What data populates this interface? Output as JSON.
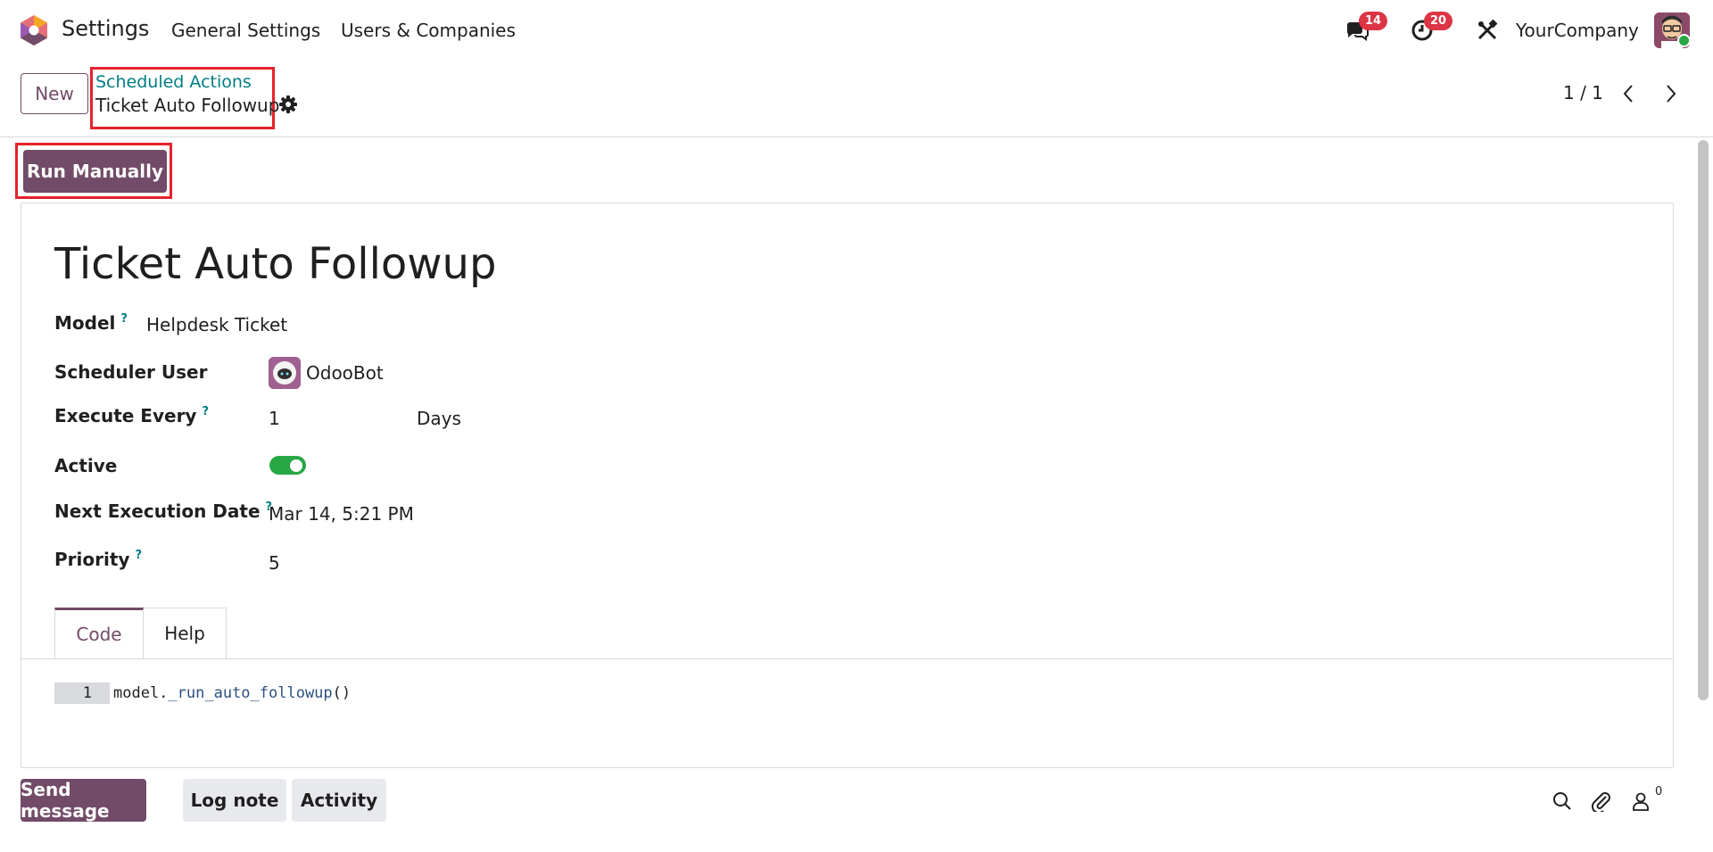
{
  "navbar": {
    "app_name": "Settings",
    "menus": [
      "General Settings",
      "Users & Companies"
    ],
    "messages_badge": "14",
    "activities_badge": "20",
    "company": "YourCompany"
  },
  "control_panel": {
    "new_label": "New",
    "breadcrumb_parent": "Scheduled Actions",
    "breadcrumb_current": "Ticket Auto Followup",
    "pager": "1 / 1"
  },
  "status_bar": {
    "run_label": "Run Manually"
  },
  "form": {
    "title": "Ticket Auto Followup",
    "fields": {
      "model_label": "Model",
      "model_value": "Helpdesk Ticket",
      "user_label": "Scheduler User",
      "user_value": "OdooBot",
      "interval_label": "Execute Every",
      "interval_number": "1",
      "interval_type": "Days",
      "active_label": "Active",
      "active_value": true,
      "nextcall_label": "Next Execution Date",
      "nextcall_value": "Mar 14, 5:21 PM",
      "priority_label": "Priority",
      "priority_value": "5"
    },
    "help_marker": "?",
    "tabs": [
      "Code",
      "Help"
    ],
    "code": {
      "line_number": "1",
      "prefix": "model.",
      "function": "_run_auto_followup",
      "suffix": "()"
    }
  },
  "chatter": {
    "send_message": "Send message",
    "log_note": "Log note",
    "activity": "Activity",
    "followers_count": "0"
  },
  "colors": {
    "brand": "#714b67",
    "link": "#017e84",
    "badge": "#dc3545",
    "toggle_on": "#28a745",
    "highlight_box": "#e4222a"
  }
}
